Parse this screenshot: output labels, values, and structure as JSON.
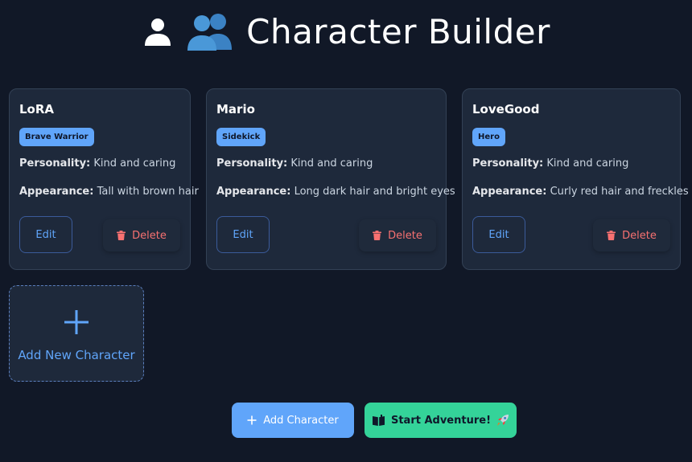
{
  "header": {
    "title": "Character Builder",
    "icons": [
      "person-icon",
      "people-icon"
    ]
  },
  "characters": [
    {
      "name": "LoRA",
      "role": "Brave Warrior",
      "personality_label": "Personality:",
      "personality": "Kind and caring",
      "appearance_label": "Appearance:",
      "appearance": "Tall with brown hair",
      "edit_label": "Edit",
      "delete_label": "Delete"
    },
    {
      "name": "Mario",
      "role": "Sidekick",
      "personality_label": "Personality:",
      "personality": "Kind and caring",
      "appearance_label": "Appearance:",
      "appearance": "Long dark hair and bright eyes",
      "edit_label": "Edit",
      "delete_label": "Delete"
    },
    {
      "name": "LoveGood",
      "role": "Hero",
      "personality_label": "Personality:",
      "personality": "Kind and caring",
      "appearance_label": "Appearance:",
      "appearance": "Curly red hair and freckles",
      "edit_label": "Edit",
      "delete_label": "Delete"
    }
  ],
  "add_tile": {
    "label": "Add New Character",
    "icon": "plus-icon"
  },
  "footer": {
    "add_character_label": "Add Character",
    "start_adventure_label": "Start Adventure!",
    "start_icons": [
      "book-icon",
      "rocket-icon"
    ]
  },
  "colors": {
    "background": "#111827",
    "card": "#1e293b",
    "accent_blue": "#60a5fa",
    "accent_green": "#34d399",
    "danger": "#f87171"
  }
}
